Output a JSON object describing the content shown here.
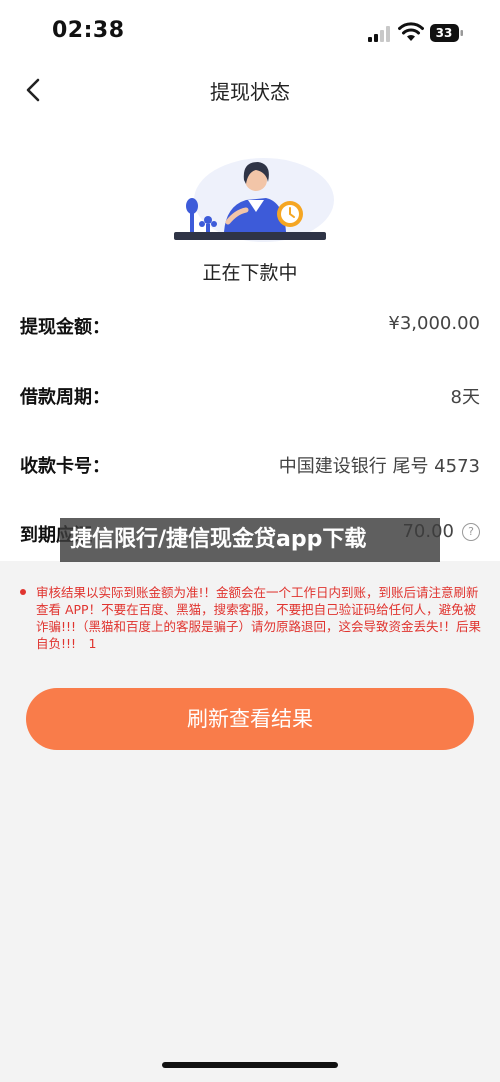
{
  "status_bar": {
    "time": "02:38",
    "battery": "33"
  },
  "nav": {
    "title": "提现状态"
  },
  "status": {
    "text": "正在下款中"
  },
  "rows": [
    {
      "label": "提现金额：",
      "value": "¥3,000.00"
    },
    {
      "label": "借款周期：",
      "value": "8天"
    },
    {
      "label": "收款卡号：",
      "value": "中国建设银行 尾号 4573"
    },
    {
      "label": "到期应还",
      "value": "70.00"
    }
  ],
  "watermark": "捷信限行/捷信现金贷app下载",
  "notice": "审核结果以实际到账金额为准!！金额会在一个工作日内到账，到账后请注意刷新查看 APP！不要在百度、黑猫，搜索客服，不要把自己验证码给任何人，避免被诈骗!!!（黑猫和百度上的客服是骗子）请勿原路退回，这会导致资金丢失!！后果自负!!!　1",
  "button": {
    "label": "刷新查看结果"
  },
  "colors": {
    "accent": "#f97c4a",
    "warning": "#e0342f"
  }
}
